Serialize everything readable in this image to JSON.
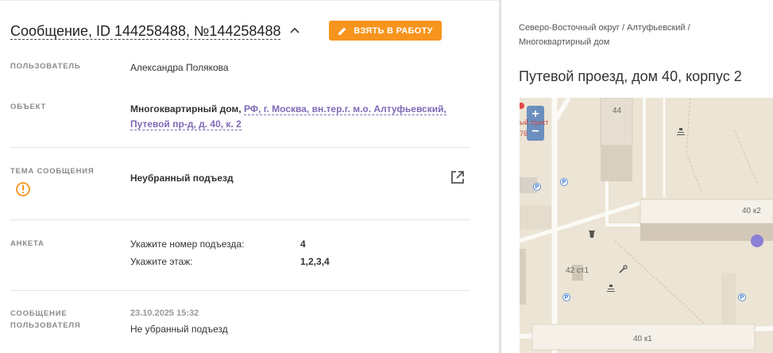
{
  "message": {
    "title": "Сообщение, ID 144258488, №144258488",
    "take_button": "ВЗЯТЬ В РАБОТУ"
  },
  "fields": {
    "user": {
      "label": "ПОЛЬЗОВАТЕЛЬ",
      "value": "Александра Полякова"
    },
    "object": {
      "label": "ОБЪЕКТ",
      "type": "Многоквартирный дом,",
      "address_line1": "РФ, г. Москва, вн.тер.г. м.о. Алтуфьевский,",
      "address_line2": "Путевой пр-д, д. 40, к. 2"
    },
    "topic": {
      "label": "ТЕМА СООБЩЕНИЯ",
      "value": "Неубранный подъезд"
    },
    "survey": {
      "label": "АНКЕТА",
      "rows": [
        {
          "q": "Укажите номер подъезда:",
          "a": "4"
        },
        {
          "q": "Укажите этаж:",
          "a": "1,2,3,4"
        }
      ]
    },
    "user_message": {
      "label_line1": "СООБЩЕНИЕ",
      "label_line2": "ПОЛЬЗОВАТЕЛЯ",
      "date": "23.10.2025 15:32",
      "text": "Не убранный подъезд"
    }
  },
  "location": {
    "breadcrumb_line1": "Северо-Восточный округ / Алтуфьевский /",
    "breadcrumb_line2": "Многоквартирный дом",
    "address": "Путевой проезд, дом 40, корпус 2"
  },
  "map": {
    "zoom_in": "+",
    "zoom_out": "−",
    "labels": {
      "b44": "44",
      "b40k2": "40 к2",
      "b42st1": "42 ст1",
      "b40k1": "40 к1",
      "poi": "ый пункт",
      "poi_num": "76"
    },
    "parking_glyph": "P",
    "marker_color": "#8c7fd6"
  },
  "colors": {
    "accent": "#f7941d",
    "link": "#7f6ab8",
    "warning": "#f7941d"
  }
}
